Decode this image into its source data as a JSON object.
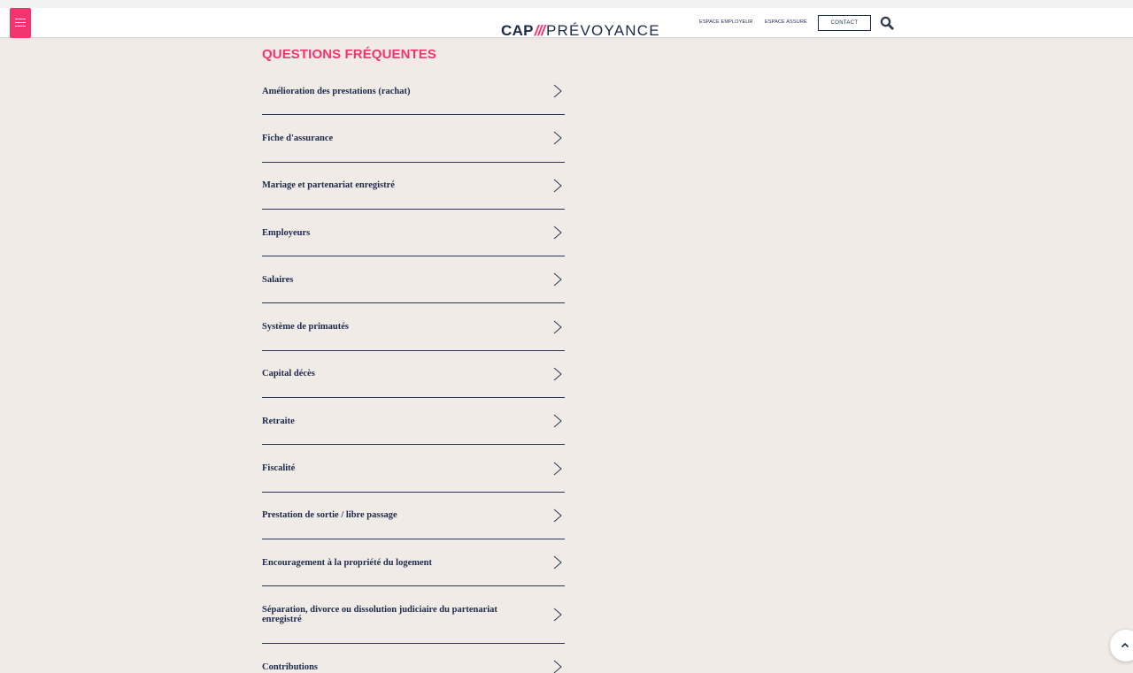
{
  "header": {
    "logo": {
      "cap": "CAP",
      "slashes": "///",
      "name": "PRÉVOYANCE"
    },
    "nav": {
      "espace_employeur": "ESPACE EMPLOYEUR",
      "espace_assure": "ESPACE ASSURÉ",
      "contact": "CONTACT"
    },
    "icons": {
      "menu": "hamburger-menu-icon",
      "search": "search-icon",
      "scroll_top": "chevron-up-icon"
    }
  },
  "colors": {
    "accent": "#f2356f",
    "navy": "#1d2a4c",
    "background": "#f0ebe7"
  },
  "faq": {
    "title": "QUESTIONS FRÉQUENTES",
    "items": [
      {
        "label": "Amélioration des prestations (rachat)"
      },
      {
        "label": "Fiche d'assurance"
      },
      {
        "label": "Mariage et partenariat enregistré"
      },
      {
        "label": "Employeurs"
      },
      {
        "label": "Salaires"
      },
      {
        "label": "Système de primautés"
      },
      {
        "label": "Capital décès"
      },
      {
        "label": "Retraite"
      },
      {
        "label": "Fiscalité"
      },
      {
        "label": "Prestation de sortie / libre passage"
      },
      {
        "label": "Encouragement à la propriété du logement"
      },
      {
        "label": "Séparation, divorce ou dissolution judiciaire du partenariat enregistré"
      },
      {
        "label": "Contributions"
      }
    ]
  }
}
